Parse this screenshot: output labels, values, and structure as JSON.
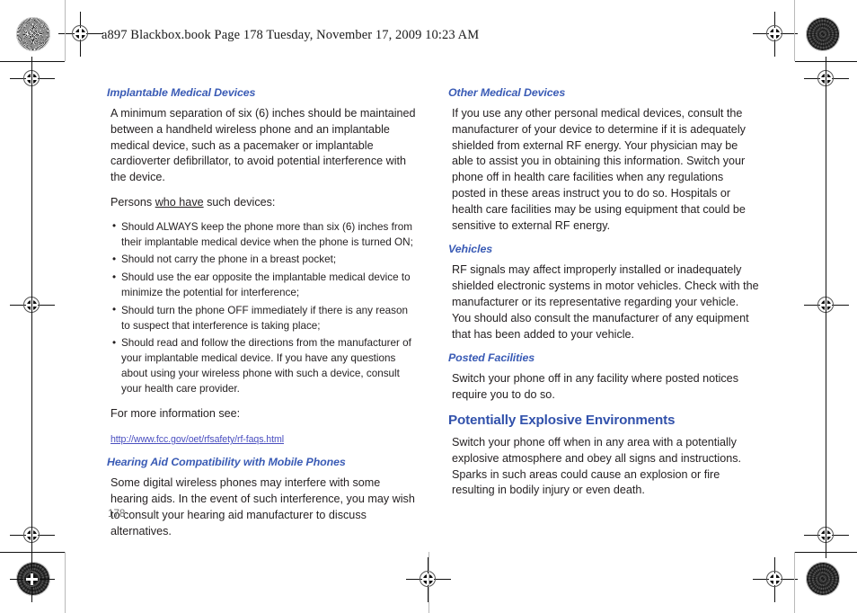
{
  "header": {
    "running_head": "a897 Blackbox.book  Page 178  Tuesday, November 17, 2009  10:23 AM"
  },
  "colors": {
    "heading_blue": "#3a5bb5",
    "h1_blue": "#3151ab",
    "link_blue": "#4a4fc0",
    "body_text": "#231f20",
    "folio_gray": "#6d6d6d"
  },
  "left_column": {
    "section_1": {
      "heading": "Implantable Medical Devices",
      "paragraph_1": "A minimum separation of six (6) inches should be maintained between a handheld wireless phone and an implantable medical device, such as a pacemaker or implantable cardioverter defibrillator, to avoid potential interference with the device.",
      "lead_in_before": "Persons ",
      "lead_in_underlined": "who have",
      "lead_in_after": " such devices:",
      "bullets": [
        "Should ALWAYS keep the phone more than six (6) inches from their implantable medical device when the phone is turned ON;",
        "Should not carry the phone in a breast pocket;",
        "Should use the ear opposite the implantable medical device to minimize the potential for interference;",
        "Should turn the phone OFF immediately if there is any reason to suspect that interference is taking place;",
        "Should read and follow the directions from the manufacturer of your implantable medical device. If you have any questions about using your wireless phone with such a device, consult your health care provider."
      ],
      "more_info_label": "For more information see:",
      "link_text": "http://www.fcc.gov/oet/rfsafety/rf-faqs.html"
    },
    "section_2": {
      "heading": "Hearing Aid Compatibility with Mobile Phones",
      "paragraph_1": "Some digital wireless phones may interfere with some hearing aids. In the event of such interference, you may wish to consult your hearing aid manufacturer to discuss alternatives."
    }
  },
  "right_column": {
    "section_1": {
      "heading": "Other Medical Devices",
      "paragraph_1": "If you use any other personal medical devices, consult the manufacturer of your device to determine if it is adequately shielded from external RF energy. Your physician may be able to assist you in obtaining this information. Switch your phone off in health care facilities when any regulations posted in these areas instruct you to do so. Hospitals or health care facilities may be using equipment that could be sensitive to external RF energy."
    },
    "section_2": {
      "heading": "Vehicles",
      "paragraph_1": "RF signals may affect improperly installed or inadequately shielded electronic systems in motor vehicles. Check with the manufacturer or its representative regarding your vehicle. You should also consult the manufacturer of any equipment that has been added to your vehicle."
    },
    "section_3": {
      "heading": "Posted Facilities",
      "paragraph_1": "Switch your phone off in any facility where posted notices require you to do so."
    },
    "section_4": {
      "heading": "Potentially Explosive Environments",
      "paragraph_1": "Switch your phone off when in any area with a potentially explosive atmosphere and obey all signs and instructions. Sparks in such areas could cause an explosion or fire resulting in bodily injury or even death."
    }
  },
  "footer": {
    "page_number": "178"
  }
}
